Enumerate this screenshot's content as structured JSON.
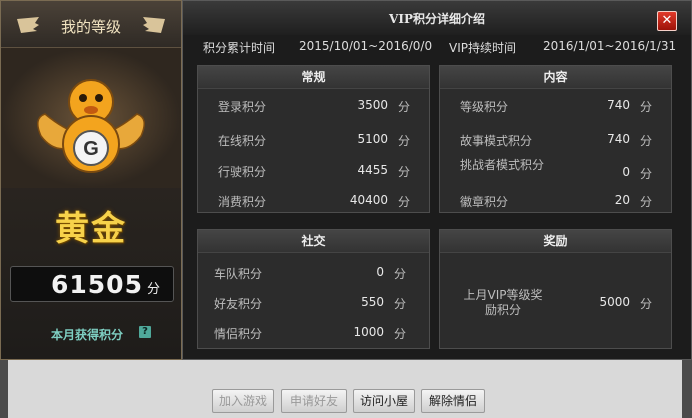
{
  "level_panel": {
    "title": "我的等级",
    "level_name": "黄金",
    "points": "61505",
    "points_unit": "分",
    "month_label": "本月获得积分",
    "help": "?"
  },
  "dialog": {
    "title": "VIP积分详细介绍",
    "close": "✕",
    "accum_label": "积分累计时间",
    "accum_value": "2015/10/01~2016/0/0",
    "duration_label": "VIP持续时间",
    "duration_value": "2016/1/01~2016/1/31"
  },
  "groups": {
    "regular": {
      "title": "常规",
      "rows": [
        {
          "label": "登录积分",
          "value": "3500",
          "unit": "分"
        },
        {
          "label": "在线积分",
          "value": "5100",
          "unit": "分"
        },
        {
          "label": "行驶积分",
          "value": "4455",
          "unit": "分"
        },
        {
          "label": "消费积分",
          "value": "40400",
          "unit": "分"
        }
      ]
    },
    "content": {
      "title": "内容",
      "rows": [
        {
          "label": "等级积分",
          "value": "740",
          "unit": "分"
        },
        {
          "label": "故事模式积分",
          "value": "740",
          "unit": "分"
        },
        {
          "label": "挑战者模式积分",
          "value": "0",
          "unit": "分"
        },
        {
          "label": "徽章积分",
          "value": "20",
          "unit": "分"
        }
      ]
    },
    "social": {
      "title": "社交",
      "rows": [
        {
          "label": "车队积分",
          "value": "0",
          "unit": "分"
        },
        {
          "label": "好友积分",
          "value": "550",
          "unit": "分"
        },
        {
          "label": "情侣积分",
          "value": "1000",
          "unit": "分"
        }
      ]
    },
    "reward": {
      "title": "奖励",
      "rows": [
        {
          "label": "上月VIP等级奖励积分",
          "value": "5000",
          "unit": "分"
        }
      ]
    }
  },
  "background_buttons": [
    "加入游戏",
    "申请好友",
    "访问小屋",
    "解除情侣"
  ],
  "colors": {
    "gold": "#f7d24a",
    "close_red": "#d22a1c",
    "teal": "#7ecfc2"
  }
}
